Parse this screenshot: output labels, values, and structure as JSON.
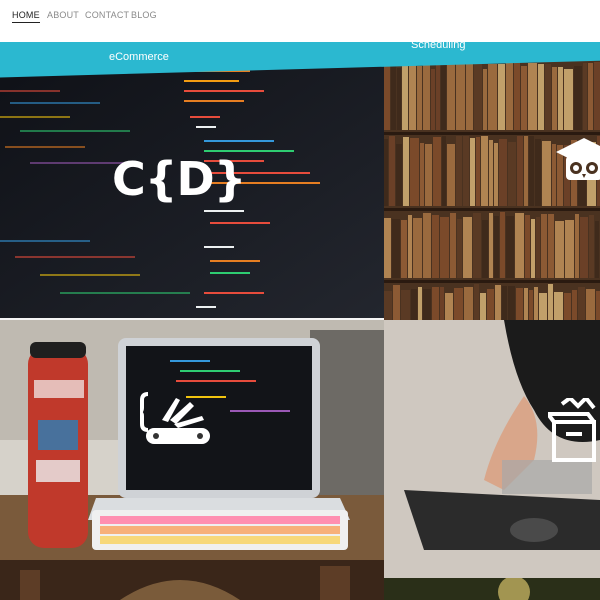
{
  "nav": {
    "items": [
      {
        "label": "HOME",
        "active": true
      },
      {
        "label": "ABOUT",
        "active": false
      },
      {
        "label": "CONTACT",
        "active": false
      },
      {
        "label": "BLOG",
        "active": false
      }
    ]
  },
  "header_strip": {
    "color": "#2bb8d0",
    "left_label": "eCommerce",
    "right_label": "Scheduling"
  },
  "tiles": {
    "code": {
      "logo_text": "C{D}",
      "icon": "code-brackets-logo"
    },
    "books": {
      "icon": "graduation-owl-icon"
    },
    "laptop": {
      "icon": "swiss-army-knife-code-icon"
    },
    "hands": {
      "icon": "box-icon"
    }
  }
}
